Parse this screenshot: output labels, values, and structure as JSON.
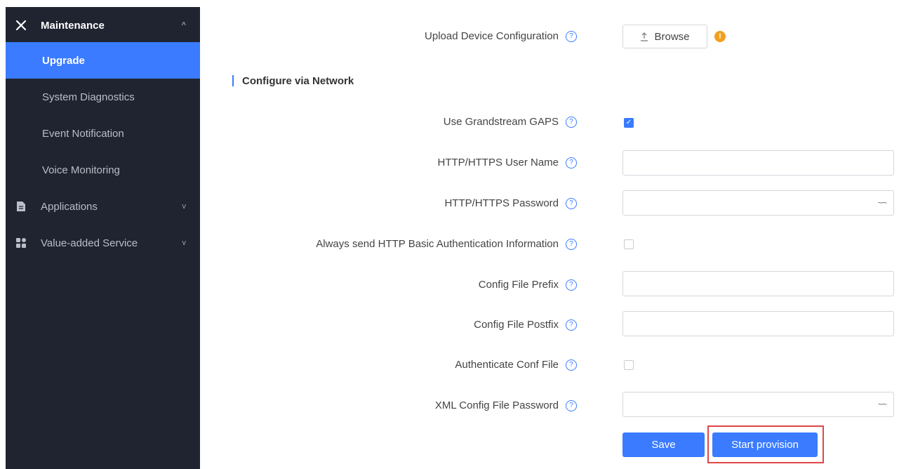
{
  "sidebar": {
    "maintenance": {
      "label": "Maintenance",
      "icon": "wrench-icon",
      "caret": "^"
    },
    "items": [
      {
        "label": "Upgrade"
      },
      {
        "label": "System Diagnostics"
      },
      {
        "label": "Event Notification"
      },
      {
        "label": "Voice Monitoring"
      }
    ],
    "applications": {
      "label": "Applications",
      "icon": "document-icon",
      "caret": "v"
    },
    "value_added": {
      "label": "Value-added Service",
      "icon": "grid-icon",
      "caret": "v"
    }
  },
  "upload": {
    "label": "Upload Device Configuration",
    "browse_label": "Browse",
    "warning": "!"
  },
  "section": {
    "title": "Configure via Network"
  },
  "fields": {
    "gaps": {
      "label": "Use Grandstream GAPS",
      "checked": true
    },
    "username": {
      "label": "HTTP/HTTPS User Name",
      "value": ""
    },
    "password": {
      "label": "HTTP/HTTPS Password",
      "value": ""
    },
    "basic_auth": {
      "label": "Always send HTTP Basic Authentication Information",
      "checked": false
    },
    "prefix": {
      "label": "Config File Prefix",
      "value": ""
    },
    "postfix": {
      "label": "Config File Postfix",
      "value": ""
    },
    "auth_conf": {
      "label": "Authenticate Conf File",
      "checked": false
    },
    "xml_password": {
      "label": "XML Config File Password",
      "value": ""
    }
  },
  "help_glyph": "?",
  "eye_glyph": "~~",
  "buttons": {
    "save": "Save",
    "start_provision": "Start provision"
  },
  "colors": {
    "accent": "#3a7bff",
    "sidebar_bg": "#1f2430",
    "highlight_border": "#e04646",
    "warning": "#f0a020"
  }
}
